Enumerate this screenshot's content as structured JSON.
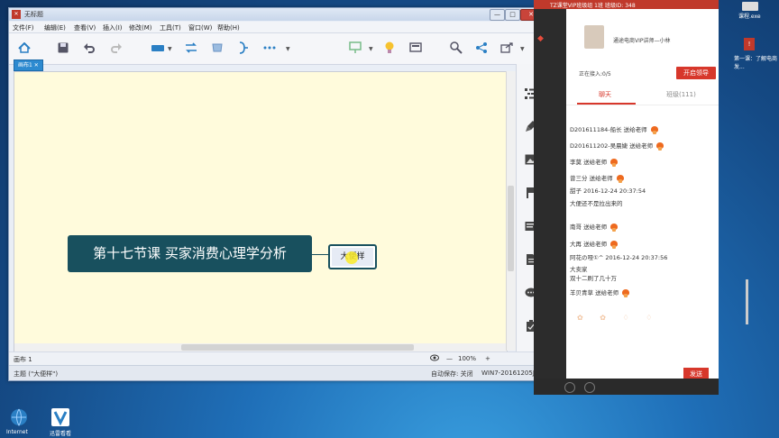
{
  "window": {
    "title": "无标题",
    "min_label": "—",
    "max_label": "□",
    "close_label": "✕"
  },
  "menu": [
    "文件(F)",
    "编辑(E)",
    "查看(V)",
    "插入(I)",
    "修改(M)",
    "工具(T)",
    "窗口(W)",
    "帮助(H)"
  ],
  "toolbar_icons": [
    "home-icon",
    "save-icon",
    "undo-icon",
    "redo-icon",
    "topic-icon",
    "relationship-icon",
    "boundary-icon",
    "summary-icon",
    "more-icon",
    "presentation-icon",
    "idea-icon",
    "display-icon",
    "zoom-icon",
    "share-icon",
    "export-icon"
  ],
  "sheet_tab": "画布1 ✕",
  "mindmap": {
    "central_topic": "第十七节课 买家消费心理学分析",
    "sub_topic": "大便样"
  },
  "status": {
    "sheet": "画布 1",
    "zoom": "100%",
    "zoom_minus": "—",
    "zoom_plus": "+",
    "selection": "主题 (\"大便样\")",
    "autosave": "自动保存: 关闭",
    "computer": "WIN7-20161205JU"
  },
  "live_panel": {
    "header": "TZ课堂VIP班级组 1班 班级ID: 348",
    "teacher": "通途电商VIP讲师—小林",
    "online": "正在接入:0/5",
    "lead_button": "开启领导",
    "tab_chat": "聊天",
    "tab_class": "班级(111)",
    "messages": [
      {
        "text": "D201611184-船长 送给老师",
        "flower": true
      },
      {
        "text": "D201611202-吴晨婕 送给老师",
        "flower": true
      },
      {
        "text": "李莫 送给老师",
        "flower": true
      },
      {
        "text": "曾三分 送给老师",
        "flower": true
      },
      {
        "text": "甜子 2016-12-24 20:37:54",
        "flower": false
      },
      {
        "text": "大便还不是拉出来的",
        "flower": false
      },
      {
        "text": "南哥 送给老师",
        "flower": true
      },
      {
        "text": "大再 送给老师",
        "flower": true
      },
      {
        "text": "阿花の哑①^ 2016-12-24 20:37:56",
        "flower": false
      },
      {
        "text": "大卖家",
        "flower": false
      },
      {
        "text": "双十二刷了几十万",
        "flower": false
      },
      {
        "text": "羊贝青草 送给老师",
        "flower": true
      }
    ],
    "emoji_row": "✿ ✿ ♢ ♢",
    "send_button": "发送"
  },
  "right_strip": {
    "item1": "课程.exe",
    "item2": "第一课：了解电商发..."
  },
  "desktop": {
    "icon1_label": "Internet",
    "icon2_label": "迅雷看看"
  }
}
